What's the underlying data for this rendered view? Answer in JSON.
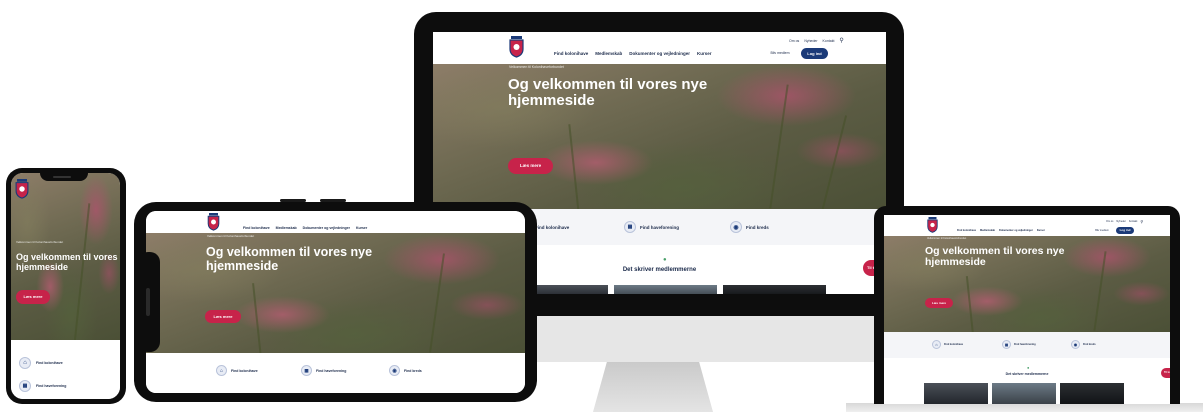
{
  "site": {
    "breadcrumb": "Velkommen til Kolonihaveforbundet",
    "hero_title_line1": "Og velkommen til vores nye",
    "hero_title_line2": "hjemmeside",
    "hero_button": "Læs mere",
    "nav": [
      "Find kolonihave",
      "Medlemskab",
      "Dokumenter og vejledninger",
      "Kurser"
    ],
    "util": [
      "Om os",
      "Nyheder",
      "Kontakt"
    ],
    "member_button": "Bliv medlem",
    "login_button": "Log ind",
    "quick_links": [
      "Find kolonihave",
      "Find haveforening",
      "Find kreds"
    ],
    "section_title": "Det skriver medlemmerne",
    "float_tab": "Til top"
  },
  "colors": {
    "accent": "#c7234a",
    "brand": "#1b3a78",
    "text": "#1b2a4a"
  },
  "icons": {
    "search": "search-icon",
    "quick_link_1": "house-icon",
    "quick_link_2": "map-icon",
    "quick_link_3": "location-pin-icon"
  }
}
